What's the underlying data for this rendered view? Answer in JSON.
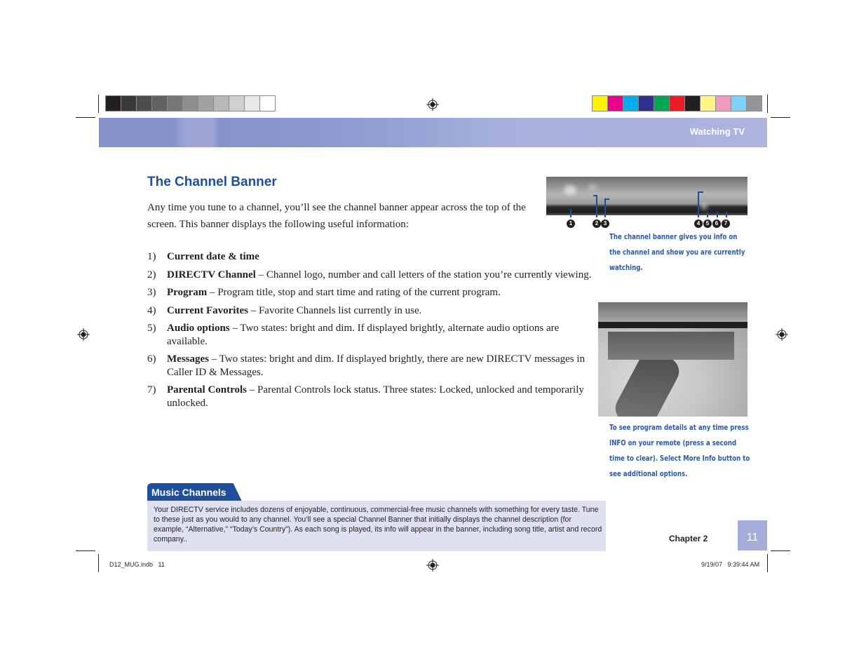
{
  "print_marks": {
    "grayscale_swatches": [
      "#231f20",
      "#3a3839",
      "#4d4d4b",
      "#626262",
      "#777777",
      "#8e8e8e",
      "#a2a2a2",
      "#b8b8b8",
      "#d0d0d0",
      "#e8e8e8",
      "#ffffff"
    ],
    "color_swatches": [
      "#fff200",
      "#ec008c",
      "#00aeef",
      "#2e3192",
      "#00a651",
      "#ed1c24",
      "#231f20",
      "#fff685",
      "#f49ac1",
      "#7dd3f7",
      "#939598"
    ]
  },
  "header": {
    "section_title": "Watching TV"
  },
  "main": {
    "title": "The Channel Banner",
    "intro": "Any time you tune to a channel, you’ll see the channel banner appear across the top of the screen. This banner displays the following useful information:",
    "features": [
      {
        "num": "1)",
        "term": "Current date & time",
        "desc": ""
      },
      {
        "num": "2)",
        "term": "DIRECTV Channel",
        "desc": " – Channel logo, number and call letters of the station you’re currently viewing."
      },
      {
        "num": "3)",
        "term": "Program",
        "desc": " – Program title, stop and start time and rating of the current program."
      },
      {
        "num": "4)",
        "term": "Current Favorites",
        "desc": " – Favorite Channels list currently in use."
      },
      {
        "num": "5)",
        "term": "Audio options",
        "desc": " – Two states: bright and dim. If displayed brightly, alternate audio options are available."
      },
      {
        "num": "6)",
        "term": "Messages",
        "desc": " – Two states: bright and dim. If displayed brightly, there are new DIRECTV messages in Caller ID & Messages."
      },
      {
        "num": "7)",
        "term": "Parental Controls",
        "desc": " – Parental Controls lock status. Three states: Locked, unlocked and temporarily unlocked."
      }
    ]
  },
  "figures": {
    "banner": {
      "callouts": [
        "1",
        "2",
        "3",
        "4",
        "5",
        "6",
        "7"
      ],
      "caption": "The channel banner gives you info on the channel and show you are currently watching."
    },
    "info": {
      "caption": "To see program details at any time press INFO on your remote (press a second time to clear). Select More Info button to see additional options."
    }
  },
  "sidebar_box": {
    "title": "Music Channels",
    "text": "Your DIRECTV service includes dozens of enjoyable, continuous, commercial-free music channels with something for every taste. Tune to these just as you would to any channel. You’ll see a special Channel Banner that initially displays the channel description (for example, “Alternative,” “Today’s Country”). As each song is played, its info will appear in the banner, including song title, artist and record company.."
  },
  "footer": {
    "chapter": "Chapter 2",
    "page_number": "11",
    "slug_file": "D12_MUG.indb   11",
    "slug_date": "9/19/07   9:39:44 AM"
  },
  "colors": {
    "title_blue": "#1f4f9c",
    "caption_blue": "#2a5aa8",
    "header_band": "#9aa4d6",
    "box_bg": "#dfe1f0",
    "page_box": "#a4acd9"
  }
}
